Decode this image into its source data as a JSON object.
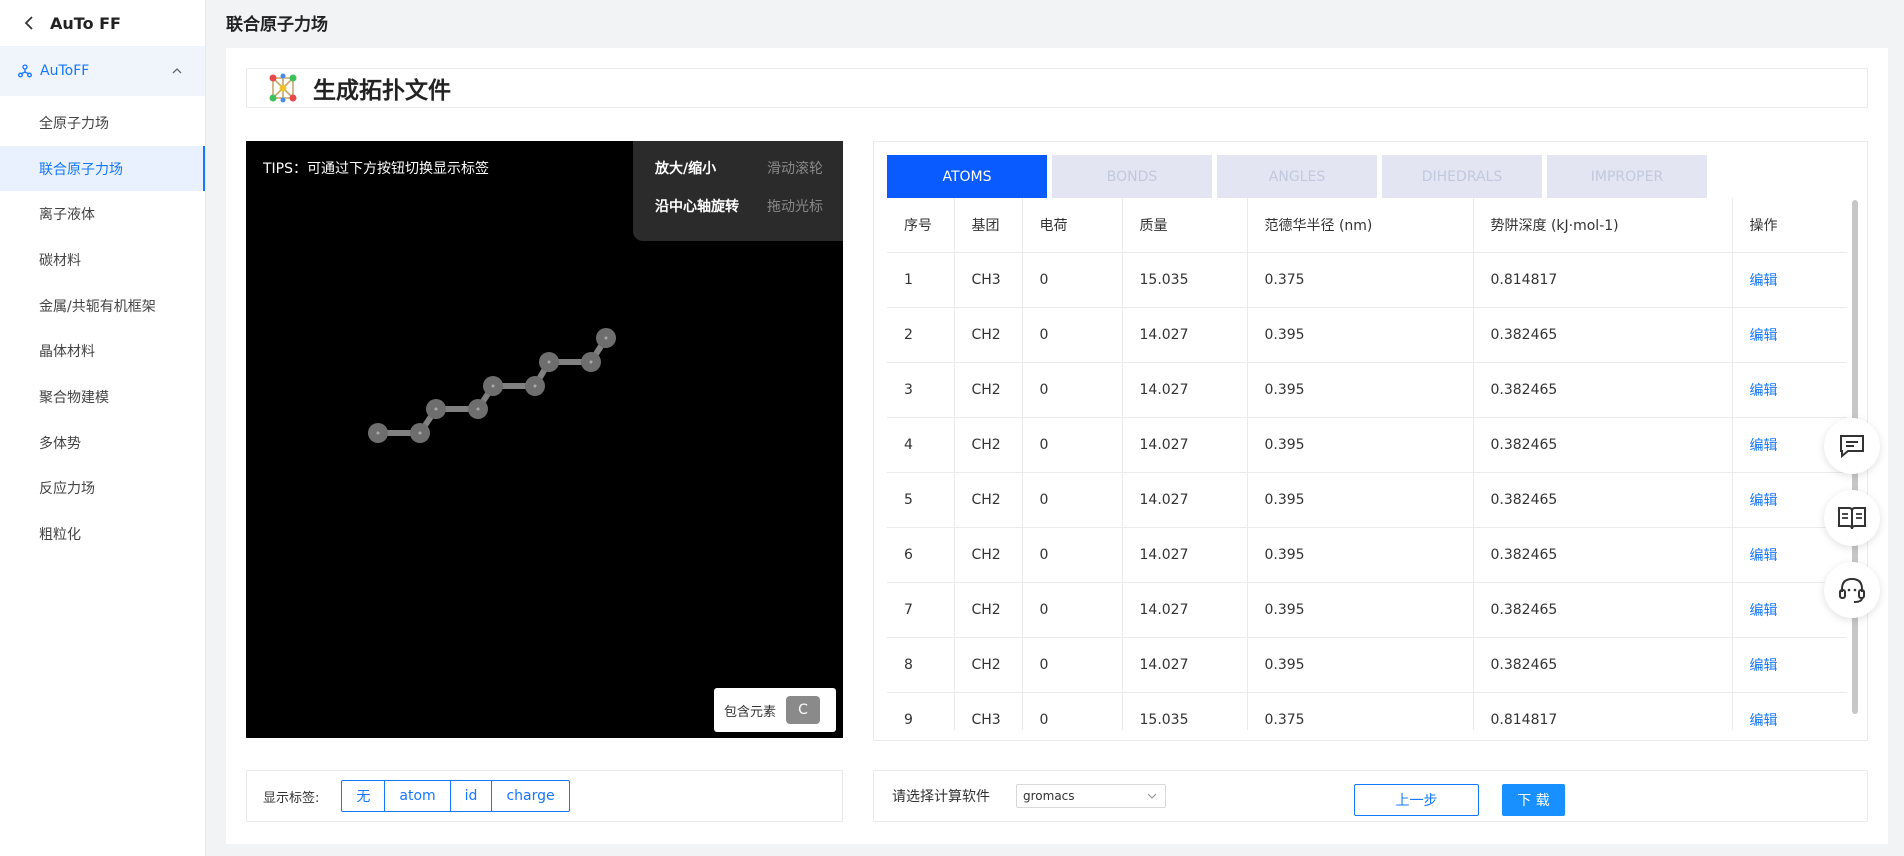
{
  "app": {
    "title": "AuTo FF"
  },
  "sidebar": {
    "group_label": "AuToFF",
    "items": [
      {
        "label": "全原子力场",
        "active": false
      },
      {
        "label": "联合原子力场",
        "active": true
      },
      {
        "label": "离子液体",
        "active": false
      },
      {
        "label": "碳材料",
        "active": false
      },
      {
        "label": "金属/共轭有机框架",
        "active": false
      },
      {
        "label": "晶体材料",
        "active": false
      },
      {
        "label": "聚合物建模",
        "active": false
      },
      {
        "label": "多体势",
        "active": false
      },
      {
        "label": "反应力场",
        "active": false
      },
      {
        "label": "粗粒化",
        "active": false
      }
    ]
  },
  "page": {
    "title": "联合原子力场",
    "section_title": "生成拓扑文件"
  },
  "viewer": {
    "tips": "TIPS：可通过下方按钮切换显示标签",
    "help": [
      {
        "action": "放大/缩小",
        "hint": "滑动滚轮"
      },
      {
        "action": "沿中心轴旋转",
        "hint": "拖动光标"
      }
    ],
    "elements_label": "包含元素",
    "element": "C",
    "colors": {
      "background": "#000000",
      "atom": "#6e6e6e",
      "bond": "#808080"
    }
  },
  "label_bar": {
    "label": "显示标签:",
    "options": [
      "无",
      "atom",
      "id",
      "charge"
    ]
  },
  "tabs": [
    {
      "label": "ATOMS",
      "active": true
    },
    {
      "label": "BONDS",
      "active": false
    },
    {
      "label": "ANGLES",
      "active": false
    },
    {
      "label": "DIHEDRALS",
      "active": false
    },
    {
      "label": "IMPROPER",
      "active": false
    }
  ],
  "table": {
    "headers": [
      "序号",
      "基团",
      "电荷",
      "质量",
      "范德华半径 (nm)",
      "势阱深度 (kJ·mol-1)",
      "操作"
    ],
    "rows": [
      [
        "1",
        "CH3",
        "0",
        "15.035",
        "0.375",
        "0.814817",
        "编辑"
      ],
      [
        "2",
        "CH2",
        "0",
        "14.027",
        "0.395",
        "0.382465",
        "编辑"
      ],
      [
        "3",
        "CH2",
        "0",
        "14.027",
        "0.395",
        "0.382465",
        "编辑"
      ],
      [
        "4",
        "CH2",
        "0",
        "14.027",
        "0.395",
        "0.382465",
        "编辑"
      ],
      [
        "5",
        "CH2",
        "0",
        "14.027",
        "0.395",
        "0.382465",
        "编辑"
      ],
      [
        "6",
        "CH2",
        "0",
        "14.027",
        "0.395",
        "0.382465",
        "编辑"
      ],
      [
        "7",
        "CH2",
        "0",
        "14.027",
        "0.395",
        "0.382465",
        "编辑"
      ],
      [
        "8",
        "CH2",
        "0",
        "14.027",
        "0.395",
        "0.382465",
        "编辑"
      ],
      [
        "9",
        "CH3",
        "0",
        "15.035",
        "0.375",
        "0.814817",
        "编辑"
      ]
    ]
  },
  "software": {
    "label": "请选择计算软件",
    "selected": "gromacs"
  },
  "actions": {
    "prev": "上一步",
    "next": "下 载"
  },
  "floating": [
    "chat-icon",
    "book-icon",
    "headset-icon"
  ],
  "accent": "#1677ff"
}
